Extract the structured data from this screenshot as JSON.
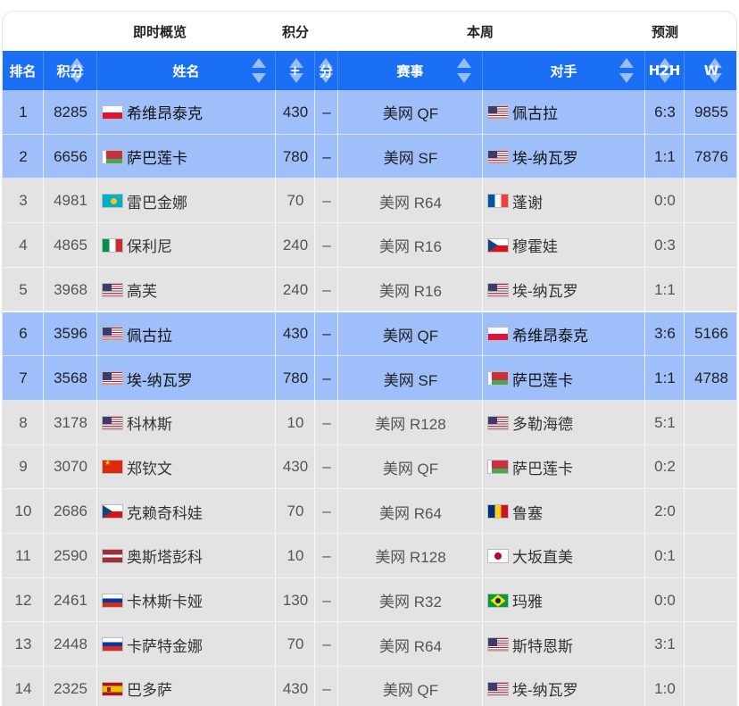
{
  "group_headers": {
    "overview": "即时概览",
    "points": "积分",
    "this_week": "本周",
    "forecast": "预测"
  },
  "columns": {
    "rank": "排名",
    "points": "积分",
    "name": "姓名",
    "change": "+",
    "sub": "分",
    "tournament": "赛事",
    "opponent": "对手",
    "h2h": "H2H",
    "w": "W"
  },
  "colors": {
    "header_blue": "#1a6ff5",
    "highlight_row": "#9ebffa",
    "plain_row": "#e3e3e3"
  },
  "rows": [
    {
      "rank": "1",
      "points": "8285",
      "flag": "pl-flag-icon",
      "flag_class": "pl",
      "name": "希维昂泰克",
      "change": "430",
      "sub": "–",
      "tournament": "美网 QF",
      "opp_flag": "us-flag-icon",
      "opp_flag_class": "us",
      "opponent": "佩古拉",
      "h2h": "6:3",
      "w": "9855",
      "highlight": true
    },
    {
      "rank": "2",
      "points": "6656",
      "flag": "by-flag-icon",
      "flag_class": "by",
      "name": "萨巴莲卡",
      "change": "780",
      "sub": "–",
      "tournament": "美网 SF",
      "opp_flag": "us-flag-icon",
      "opp_flag_class": "us",
      "opponent": "埃-纳瓦罗",
      "h2h": "1:1",
      "w": "7876",
      "highlight": true
    },
    {
      "rank": "3",
      "points": "4981",
      "flag": "kz-flag-icon",
      "flag_class": "kz",
      "name": "雷巴金娜",
      "change": "70",
      "sub": "–",
      "tournament": "美网 R64",
      "opp_flag": "fr-flag-icon",
      "opp_flag_class": "fr",
      "opponent": "蓬谢",
      "h2h": "0:0",
      "w": "",
      "highlight": false
    },
    {
      "rank": "4",
      "points": "4865",
      "flag": "it-flag-icon",
      "flag_class": "it",
      "name": "保利尼",
      "change": "240",
      "sub": "–",
      "tournament": "美网 R16",
      "opp_flag": "cz-flag-icon",
      "opp_flag_class": "cz",
      "opponent": "穆霍娃",
      "h2h": "0:3",
      "w": "",
      "highlight": false
    },
    {
      "rank": "5",
      "points": "3968",
      "flag": "us-flag-icon",
      "flag_class": "us",
      "name": "高芙",
      "change": "240",
      "sub": "–",
      "tournament": "美网 R16",
      "opp_flag": "us-flag-icon",
      "opp_flag_class": "us",
      "opponent": "埃-纳瓦罗",
      "h2h": "1:1",
      "w": "",
      "highlight": false
    },
    {
      "rank": "6",
      "points": "3596",
      "flag": "us-flag-icon",
      "flag_class": "us",
      "name": "佩古拉",
      "change": "430",
      "sub": "–",
      "tournament": "美网 QF",
      "opp_flag": "pl-flag-icon",
      "opp_flag_class": "pl",
      "opponent": "希维昂泰克",
      "h2h": "3:6",
      "w": "5166",
      "highlight": true
    },
    {
      "rank": "7",
      "points": "3568",
      "flag": "us-flag-icon",
      "flag_class": "us",
      "name": "埃-纳瓦罗",
      "change": "780",
      "sub": "–",
      "tournament": "美网 SF",
      "opp_flag": "by-flag-icon",
      "opp_flag_class": "by",
      "opponent": "萨巴莲卡",
      "h2h": "1:1",
      "w": "4788",
      "highlight": true
    },
    {
      "rank": "8",
      "points": "3178",
      "flag": "us-flag-icon",
      "flag_class": "us",
      "name": "科林斯",
      "change": "10",
      "sub": "–",
      "tournament": "美网 R128",
      "opp_flag": "us-flag-icon",
      "opp_flag_class": "us",
      "opponent": "多勒海德",
      "h2h": "5:1",
      "w": "",
      "highlight": false
    },
    {
      "rank": "9",
      "points": "3070",
      "flag": "cn-flag-icon",
      "flag_class": "cn",
      "name": "郑钦文",
      "change": "430",
      "sub": "–",
      "tournament": "美网 QF",
      "opp_flag": "by-flag-icon",
      "opp_flag_class": "by",
      "opponent": "萨巴莲卡",
      "h2h": "0:2",
      "w": "",
      "highlight": false
    },
    {
      "rank": "10",
      "points": "2686",
      "flag": "cz-flag-icon",
      "flag_class": "cz",
      "name": "克赖奇科娃",
      "change": "70",
      "sub": "–",
      "tournament": "美网 R64",
      "opp_flag": "ro-flag-icon",
      "opp_flag_class": "ro",
      "opponent": "鲁塞",
      "h2h": "2:0",
      "w": "",
      "highlight": false
    },
    {
      "rank": "11",
      "points": "2590",
      "flag": "lv-flag-icon",
      "flag_class": "lv",
      "name": "奥斯塔彭科",
      "change": "10",
      "sub": "–",
      "tournament": "美网 R128",
      "opp_flag": "jp-flag-icon",
      "opp_flag_class": "jp",
      "opponent": "大坂直美",
      "h2h": "0:1",
      "w": "",
      "highlight": false
    },
    {
      "rank": "12",
      "points": "2461",
      "flag": "ru-flag-icon",
      "flag_class": "ru",
      "name": "卡林斯卡娅",
      "change": "130",
      "sub": "–",
      "tournament": "美网 R32",
      "opp_flag": "br-flag-icon",
      "opp_flag_class": "br",
      "opponent": "玛雅",
      "h2h": "0:0",
      "w": "",
      "highlight": false
    },
    {
      "rank": "13",
      "points": "2448",
      "flag": "ru-flag-icon",
      "flag_class": "ru",
      "name": "卡萨特金娜",
      "change": "70",
      "sub": "–",
      "tournament": "美网 R64",
      "opp_flag": "us-flag-icon",
      "opp_flag_class": "us",
      "opponent": "斯特恩斯",
      "h2h": "3:1",
      "w": "",
      "highlight": false
    },
    {
      "rank": "14",
      "points": "2325",
      "flag": "es-flag-icon",
      "flag_class": "es",
      "name": "巴多萨",
      "change": "430",
      "sub": "–",
      "tournament": "美网 QF",
      "opp_flag": "us-flag-icon",
      "opp_flag_class": "us",
      "opponent": "埃-纳瓦罗",
      "h2h": "1:0",
      "w": "",
      "highlight": false
    }
  ]
}
